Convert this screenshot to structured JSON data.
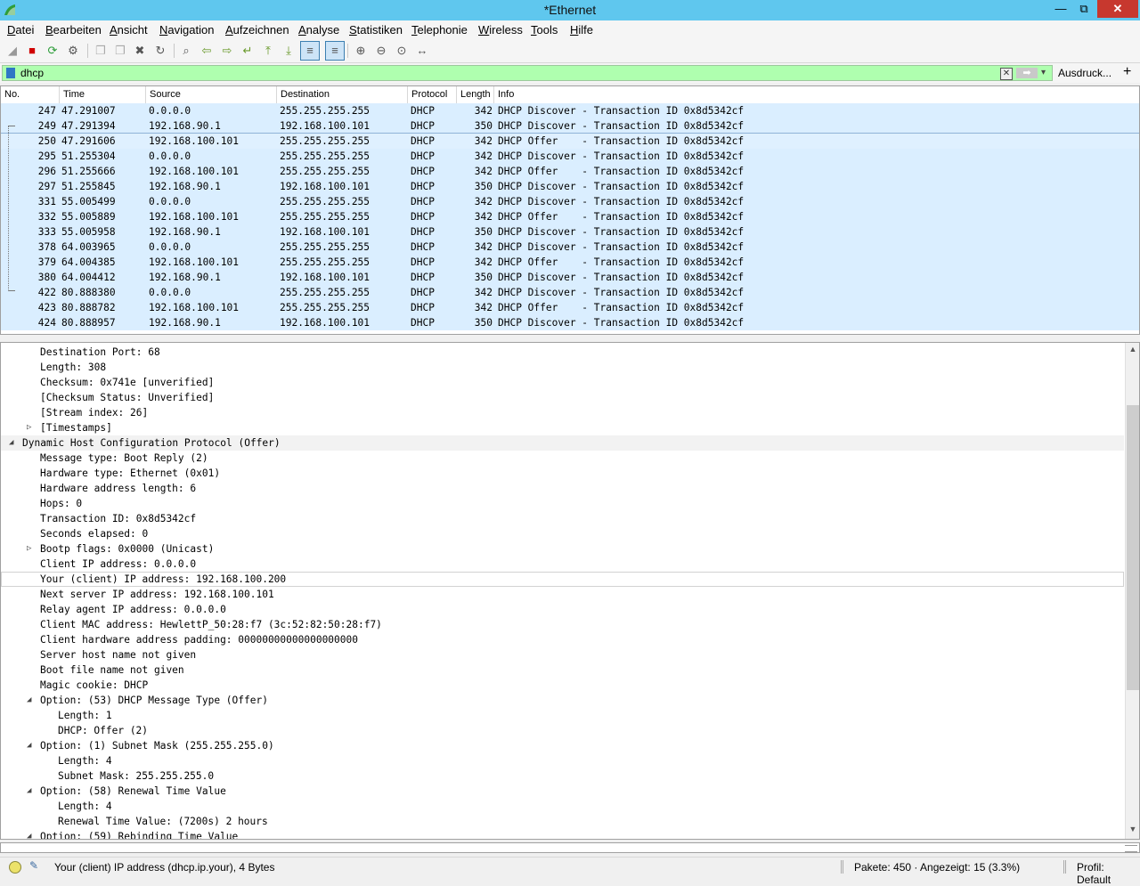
{
  "window": {
    "title": "*Ethernet",
    "min": "—",
    "max": "⧉",
    "close": "✕"
  },
  "menu": [
    "Datei",
    "Bearbeiten",
    "Ansicht",
    "Navigation",
    "Aufzeichnen",
    "Analyse",
    "Statistiken",
    "Telephonie",
    "Wireless",
    "Tools",
    "Hilfe"
  ],
  "toolbar": {
    "icons": [
      "shark-fin-start-icon",
      "stop-capture-icon",
      "restart-capture-icon",
      "capture-options-icon",
      "open-file-icon",
      "save-file-icon",
      "close-file-icon",
      "reload-file-icon",
      "find-packet-icon",
      "go-back-icon",
      "go-forward-icon",
      "go-to-packet-icon",
      "first-packet-icon",
      "last-packet-icon",
      "autoscroll-icon",
      "colorize-icon",
      "zoom-in-icon",
      "zoom-out-icon",
      "zoom-reset-icon",
      "resize-columns-icon"
    ],
    "glyphs": [
      "◢",
      "■",
      "⟳",
      "⚙",
      "❐",
      "❐",
      "✖",
      "↻",
      "⌕",
      "⇦",
      "⇨",
      "↵",
      "⤒",
      "⤓",
      "≡",
      "≡",
      "⊕",
      "⊖",
      "⊙",
      "↔"
    ]
  },
  "filter": {
    "value": "dhcp",
    "clear": "✕",
    "apply": "➡",
    "dropdown": "▾",
    "expressions_label": "Ausdruck...",
    "add": "+"
  },
  "columns": [
    "No.",
    "Time",
    "Source",
    "Destination",
    "Protocol",
    "Length",
    "Info"
  ],
  "packets": [
    {
      "no": "247",
      "time": "47.291007",
      "src": "0.0.0.0",
      "dst": "255.255.255.255",
      "proto": "DHCP",
      "len": "342",
      "info": "DHCP Discover - Transaction ID 0x8d5342cf"
    },
    {
      "no": "249",
      "time": "47.291394",
      "src": "192.168.90.1",
      "dst": "192.168.100.101",
      "proto": "DHCP",
      "len": "350",
      "info": "DHCP Discover - Transaction ID 0x8d5342cf"
    },
    {
      "no": "250",
      "time": "47.291606",
      "src": "192.168.100.101",
      "dst": "255.255.255.255",
      "proto": "DHCP",
      "len": "342",
      "info": "DHCP Offer    - Transaction ID 0x8d5342cf",
      "selected": true
    },
    {
      "no": "295",
      "time": "51.255304",
      "src": "0.0.0.0",
      "dst": "255.255.255.255",
      "proto": "DHCP",
      "len": "342",
      "info": "DHCP Discover - Transaction ID 0x8d5342cf"
    },
    {
      "no": "296",
      "time": "51.255666",
      "src": "192.168.100.101",
      "dst": "255.255.255.255",
      "proto": "DHCP",
      "len": "342",
      "info": "DHCP Offer    - Transaction ID 0x8d5342cf"
    },
    {
      "no": "297",
      "time": "51.255845",
      "src": "192.168.90.1",
      "dst": "192.168.100.101",
      "proto": "DHCP",
      "len": "350",
      "info": "DHCP Discover - Transaction ID 0x8d5342cf"
    },
    {
      "no": "331",
      "time": "55.005499",
      "src": "0.0.0.0",
      "dst": "255.255.255.255",
      "proto": "DHCP",
      "len": "342",
      "info": "DHCP Discover - Transaction ID 0x8d5342cf"
    },
    {
      "no": "332",
      "time": "55.005889",
      "src": "192.168.100.101",
      "dst": "255.255.255.255",
      "proto": "DHCP",
      "len": "342",
      "info": "DHCP Offer    - Transaction ID 0x8d5342cf"
    },
    {
      "no": "333",
      "time": "55.005958",
      "src": "192.168.90.1",
      "dst": "192.168.100.101",
      "proto": "DHCP",
      "len": "350",
      "info": "DHCP Discover - Transaction ID 0x8d5342cf"
    },
    {
      "no": "378",
      "time": "64.003965",
      "src": "0.0.0.0",
      "dst": "255.255.255.255",
      "proto": "DHCP",
      "len": "342",
      "info": "DHCP Discover - Transaction ID 0x8d5342cf"
    },
    {
      "no": "379",
      "time": "64.004385",
      "src": "192.168.100.101",
      "dst": "255.255.255.255",
      "proto": "DHCP",
      "len": "342",
      "info": "DHCP Offer    - Transaction ID 0x8d5342cf"
    },
    {
      "no": "380",
      "time": "64.004412",
      "src": "192.168.90.1",
      "dst": "192.168.100.101",
      "proto": "DHCP",
      "len": "350",
      "info": "DHCP Discover - Transaction ID 0x8d5342cf"
    },
    {
      "no": "422",
      "time": "80.888380",
      "src": "0.0.0.0",
      "dst": "255.255.255.255",
      "proto": "DHCP",
      "len": "342",
      "info": "DHCP Discover - Transaction ID 0x8d5342cf"
    },
    {
      "no": "423",
      "time": "80.888782",
      "src": "192.168.100.101",
      "dst": "255.255.255.255",
      "proto": "DHCP",
      "len": "342",
      "info": "DHCP Offer    - Transaction ID 0x8d5342cf"
    },
    {
      "no": "424",
      "time": "80.888957",
      "src": "192.168.90.1",
      "dst": "192.168.100.101",
      "proto": "DHCP",
      "len": "350",
      "info": "DHCP Discover - Transaction ID 0x8d5342cf"
    }
  ],
  "details": [
    {
      "level": 2,
      "text": "Destination Port: 68"
    },
    {
      "level": 2,
      "text": "Length: 308"
    },
    {
      "level": 2,
      "text": "Checksum: 0x741e [unverified]"
    },
    {
      "level": 2,
      "text": "[Checksum Status: Unverified]"
    },
    {
      "level": 2,
      "text": "[Stream index: 26]"
    },
    {
      "level": 2,
      "text": "[Timestamps]",
      "toggle": "collapsed"
    },
    {
      "level": 1,
      "text": "Dynamic Host Configuration Protocol (Offer)",
      "toggle": "expanded",
      "section": true
    },
    {
      "level": 2,
      "text": "Message type: Boot Reply (2)"
    },
    {
      "level": 2,
      "text": "Hardware type: Ethernet (0x01)"
    },
    {
      "level": 2,
      "text": "Hardware address length: 6"
    },
    {
      "level": 2,
      "text": "Hops: 0"
    },
    {
      "level": 2,
      "text": "Transaction ID: 0x8d5342cf"
    },
    {
      "level": 2,
      "text": "Seconds elapsed: 0"
    },
    {
      "level": 2,
      "text": "Bootp flags: 0x0000 (Unicast)",
      "toggle": "collapsed"
    },
    {
      "level": 2,
      "text": "Client IP address: 0.0.0.0"
    },
    {
      "level": 2,
      "text": "Your (client) IP address: 192.168.100.200",
      "selected": true
    },
    {
      "level": 2,
      "text": "Next server IP address: 192.168.100.101"
    },
    {
      "level": 2,
      "text": "Relay agent IP address: 0.0.0.0"
    },
    {
      "level": 2,
      "text": "Client MAC address: HewlettP_50:28:f7 (3c:52:82:50:28:f7)"
    },
    {
      "level": 2,
      "text": "Client hardware address padding: 00000000000000000000"
    },
    {
      "level": 2,
      "text": "Server host name not given"
    },
    {
      "level": 2,
      "text": "Boot file name not given"
    },
    {
      "level": 2,
      "text": "Magic cookie: DHCP"
    },
    {
      "level": 2,
      "text": "Option: (53) DHCP Message Type (Offer)",
      "toggle": "expanded"
    },
    {
      "level": 3,
      "text": "Length: 1"
    },
    {
      "level": 3,
      "text": "DHCP: Offer (2)"
    },
    {
      "level": 2,
      "text": "Option: (1) Subnet Mask (255.255.255.0)",
      "toggle": "expanded"
    },
    {
      "level": 3,
      "text": "Length: 4"
    },
    {
      "level": 3,
      "text": "Subnet Mask: 255.255.255.0"
    },
    {
      "level": 2,
      "text": "Option: (58) Renewal Time Value",
      "toggle": "expanded"
    },
    {
      "level": 3,
      "text": "Length: 4"
    },
    {
      "level": 3,
      "text": "Renewal Time Value: (7200s) 2 hours"
    },
    {
      "level": 2,
      "text": "Option: (59) Rebinding Time Value",
      "toggle": "expanded"
    }
  ],
  "status": {
    "field_text": "Your (client) IP address (dhcp.ip.your), 4 Bytes",
    "packets": "Pakete: 450 · Angezeigt: 15 (3.3%)",
    "profile": "Profil: Default",
    "edit_glyph": "✎"
  },
  "glyphs": {
    "expanded": "◢",
    "collapsed": "▷",
    "scroll_up": "▲",
    "scroll_down": "▼"
  },
  "colors": {
    "titlebar": "#5fc7ee",
    "filter_ok": "#afffaf",
    "dhcp_row": "#daeeff",
    "close_button": "#c7382e"
  }
}
